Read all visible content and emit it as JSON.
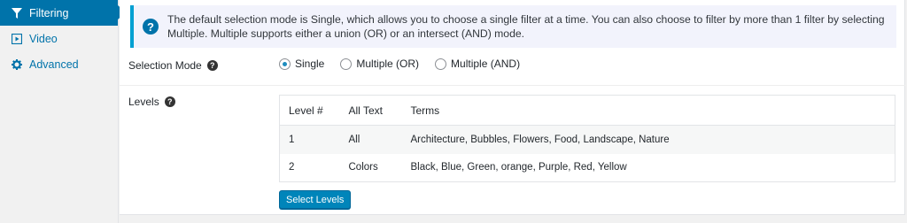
{
  "sidebar": {
    "items": [
      {
        "label": "Filtering",
        "icon": "filter-icon",
        "active": true
      },
      {
        "label": "Video",
        "icon": "video-icon",
        "active": false
      },
      {
        "label": "Advanced",
        "icon": "gear-icon",
        "active": false
      }
    ]
  },
  "notice": {
    "icon": "question-icon",
    "text": "The default selection mode is Single, which allows you to choose a single filter at a time. You can also choose to filter by more than 1 filter by selecting Multiple. Multiple supports either a union (OR) or an intersect (AND) mode."
  },
  "selection_mode": {
    "label": "Selection Mode",
    "options": [
      {
        "label": "Single",
        "checked": true
      },
      {
        "label": "Multiple (OR)",
        "checked": false
      },
      {
        "label": "Multiple (AND)",
        "checked": false
      }
    ]
  },
  "levels": {
    "label": "Levels",
    "columns": [
      "Level #",
      "All Text",
      "Terms"
    ],
    "rows": [
      {
        "level": "1",
        "all_text": "All",
        "terms": "Architecture, Bubbles, Flowers, Food, Landscape, Nature"
      },
      {
        "level": "2",
        "all_text": "Colors",
        "terms": "Black, Blue, Green, orange, Purple, Red, Yellow"
      }
    ],
    "button_label": "Select Levels"
  },
  "colors": {
    "accent": "#0073aa",
    "button": "#0085ba",
    "notice_border": "#00a0d2"
  }
}
